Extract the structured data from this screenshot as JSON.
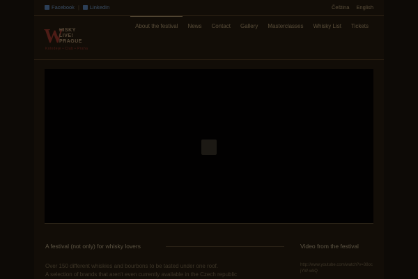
{
  "topbar": {
    "social": [
      {
        "label": "Facebook",
        "icon": "facebook-icon"
      },
      {
        "label": "LinkedIn",
        "icon": "linkedin-icon"
      }
    ],
    "languages": [
      "Čeština",
      "English"
    ]
  },
  "logo": {
    "letter": "W",
    "line1": "HISKY",
    "line2": "LIVE!",
    "line3": "PRAGUE",
    "tagline": "Kolodeje • Club • Praha"
  },
  "nav": {
    "items": [
      "About the festival",
      "News",
      "Contact",
      "Gallery",
      "Masterclasses",
      "Whisky List",
      "Tickets"
    ],
    "active_index": 0
  },
  "video": {
    "play_icon": "play-icon"
  },
  "main": {
    "heading": "A festival (not only) for whisky lovers",
    "line1": "Over 150 different whiskies and bourbons to be tasted under one roof.",
    "line2": "A selection of brands that aren't even currently available in the Czech republic"
  },
  "sidebar": {
    "heading": "Video from the festival",
    "link": "http://www.youtube.com/watch?v=38ocjYW-wkQ"
  },
  "colors": {
    "background": "#0d0a06",
    "logo_accent": "#4e1c16",
    "social_link": "#3a4f66"
  }
}
